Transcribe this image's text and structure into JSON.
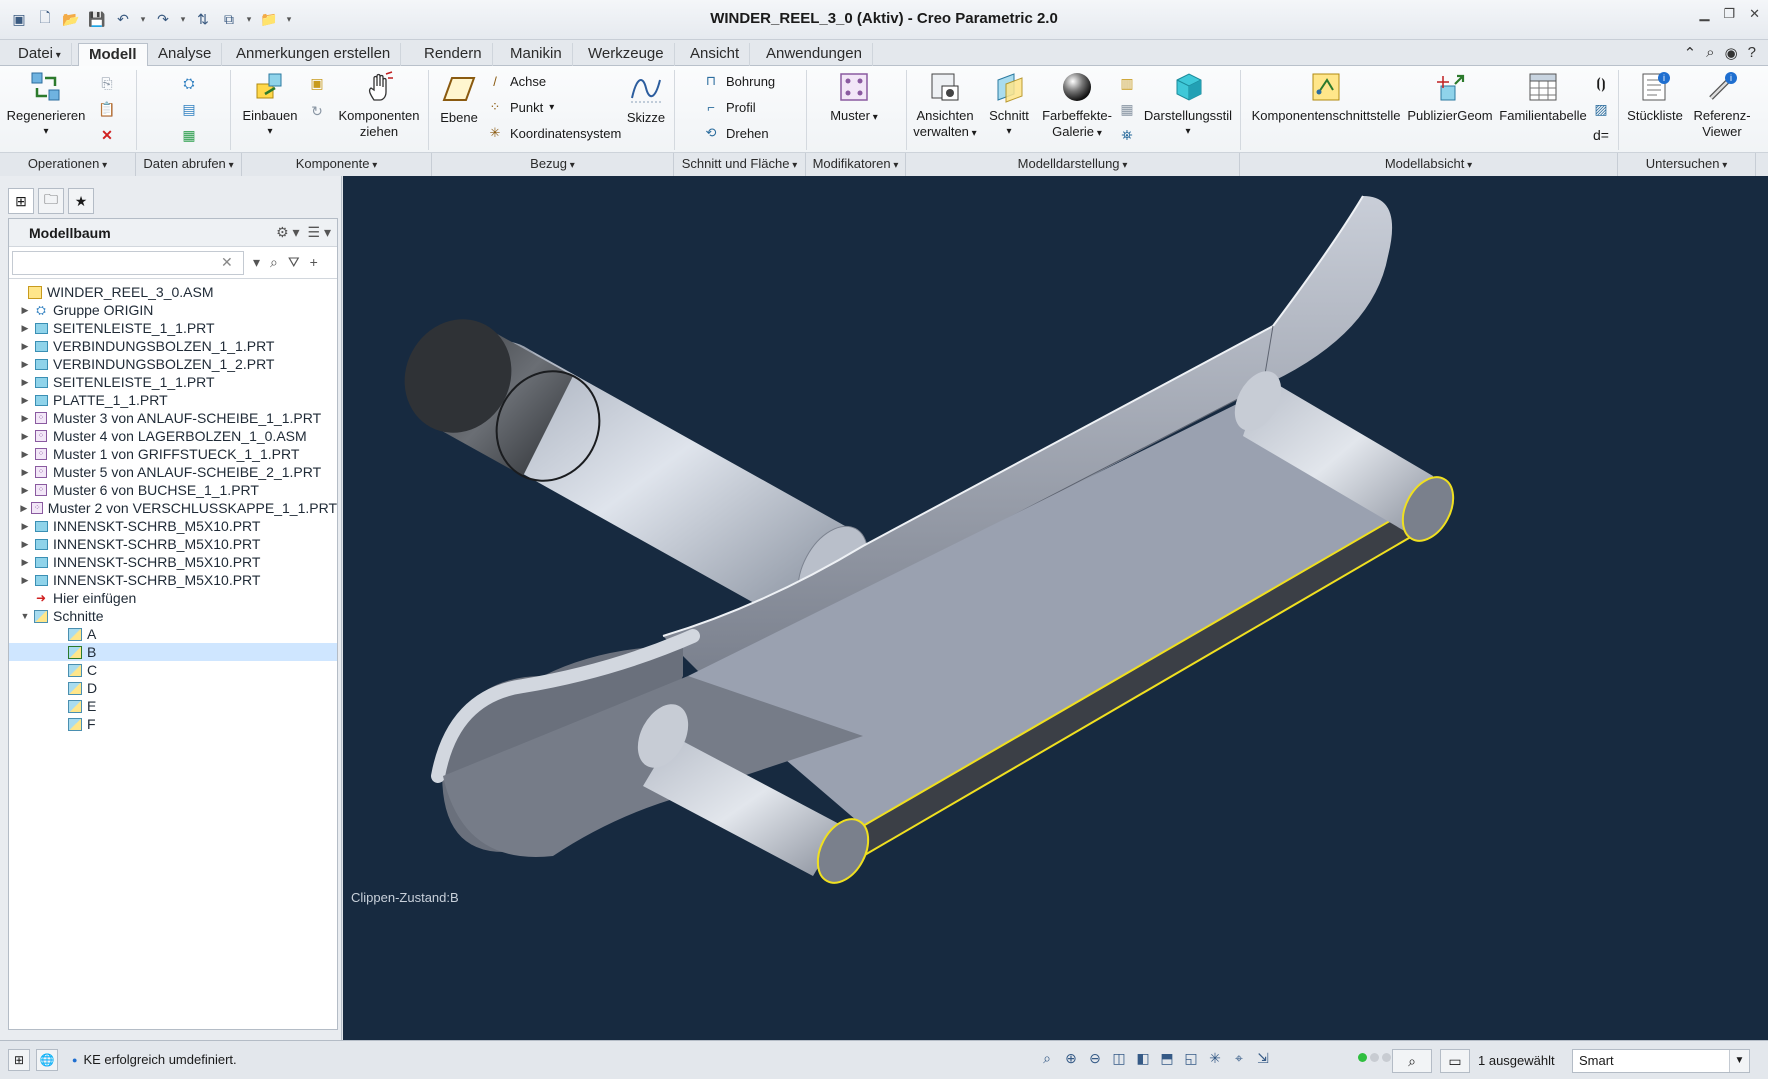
{
  "window": {
    "title": "WINDER_REEL_3_0 (Aktiv) - Creo Parametric 2.0"
  },
  "tabs": [
    {
      "label": "Datei",
      "active": false
    },
    {
      "label": "Modell",
      "active": true
    },
    {
      "label": "Analyse",
      "active": false
    },
    {
      "label": "Anmerkungen erstellen",
      "active": false
    },
    {
      "label": "Rendern",
      "active": false
    },
    {
      "label": "Manikin",
      "active": false
    },
    {
      "label": "Werkzeuge",
      "active": false
    },
    {
      "label": "Ansicht",
      "active": false
    },
    {
      "label": "Anwendungen",
      "active": false
    }
  ],
  "ribbon": {
    "regenerate": "Regenerieren",
    "assemble": "Einbauen",
    "drag_components": [
      "Komponenten",
      "ziehen"
    ],
    "plane": "Ebene",
    "axis": "Achse",
    "point": "Punkt",
    "csys": "Koordinatensystem",
    "sketch": "Skizze",
    "hole": "Bohrung",
    "profile": "Profil",
    "revolve": "Drehen",
    "pattern": "Muster",
    "manage_views": [
      "Ansichten",
      "verwalten"
    ],
    "section": "Schnitt",
    "appearance_gallery": [
      "Farbeffekte-",
      "Galerie"
    ],
    "display_style": "Darstellungsstil",
    "component_interface": "Komponentenschnittstelle",
    "publish_geom": "PublizierGeom",
    "family_table": "Familientabelle",
    "bom": "Stückliste",
    "reference_viewer": [
      "Referenz-",
      "Viewer"
    ]
  },
  "groups": [
    {
      "label": "Operationen"
    },
    {
      "label": "Daten abrufen"
    },
    {
      "label": "Komponente"
    },
    {
      "label": "Bezug"
    },
    {
      "label": "Schnitt und Fläche"
    },
    {
      "label": "Modifikatoren"
    },
    {
      "label": "Modelldarstellung"
    },
    {
      "label": "Modellabsicht"
    },
    {
      "label": "Untersuchen"
    }
  ],
  "model_tree": {
    "title": "Modellbaum",
    "search_value": "",
    "items": [
      {
        "label": "WINDER_REEL_3_0.ASM",
        "type": "asm",
        "level": 0,
        "expander": ""
      },
      {
        "label": "Gruppe ORIGIN",
        "type": "group",
        "level": 1,
        "expander": "▶"
      },
      {
        "label": "SEITENLEISTE_1_1.PRT",
        "type": "prt",
        "level": 1,
        "expander": "▶"
      },
      {
        "label": "VERBINDUNGSBOLZEN_1_1.PRT",
        "type": "prt",
        "level": 1,
        "expander": "▶"
      },
      {
        "label": "VERBINDUNGSBOLZEN_1_2.PRT",
        "type": "prt",
        "level": 1,
        "expander": "▶"
      },
      {
        "label": "SEITENLEISTE_1_1.PRT",
        "type": "prt",
        "level": 1,
        "expander": "▶"
      },
      {
        "label": "PLATTE_1_1.PRT",
        "type": "prt",
        "level": 1,
        "expander": "▶"
      },
      {
        "label": "Muster 3 von ANLAUF-SCHEIBE_1_1.PRT",
        "type": "pat",
        "level": 1,
        "expander": "▶"
      },
      {
        "label": "Muster 4 von LAGERBOLZEN_1_0.ASM",
        "type": "pat",
        "level": 1,
        "expander": "▶"
      },
      {
        "label": "Muster 1 von GRIFFSTUECK_1_1.PRT",
        "type": "pat",
        "level": 1,
        "expander": "▶"
      },
      {
        "label": "Muster 5 von ANLAUF-SCHEIBE_2_1.PRT",
        "type": "pat",
        "level": 1,
        "expander": "▶"
      },
      {
        "label": "Muster 6 von BUCHSE_1_1.PRT",
        "type": "pat",
        "level": 1,
        "expander": "▶"
      },
      {
        "label": "Muster 2 von VERSCHLUSSKAPPE_1_1.PRT",
        "type": "pat",
        "level": 1,
        "expander": "▶"
      },
      {
        "label": "INNENSKT-SCHRB_M5X10.PRT",
        "type": "prt",
        "level": 1,
        "expander": "▶"
      },
      {
        "label": "INNENSKT-SCHRB_M5X10.PRT",
        "type": "prt",
        "level": 1,
        "expander": "▶"
      },
      {
        "label": "INNENSKT-SCHRB_M5X10.PRT",
        "type": "prt",
        "level": 1,
        "expander": "▶"
      },
      {
        "label": "INNENSKT-SCHRB_M5X10.PRT",
        "type": "prt",
        "level": 1,
        "expander": "▶"
      },
      {
        "label": "Hier einfügen",
        "type": "insert",
        "level": 1,
        "expander": ""
      },
      {
        "label": "Schnitte",
        "type": "folder",
        "level": 1,
        "expander": "▼"
      },
      {
        "label": "A",
        "type": "sect",
        "level": 2,
        "expander": ""
      },
      {
        "label": "B",
        "type": "sect-active",
        "level": 2,
        "expander": "",
        "selected": true
      },
      {
        "label": "C",
        "type": "sect",
        "level": 2,
        "expander": ""
      },
      {
        "label": "D",
        "type": "sect",
        "level": 2,
        "expander": ""
      },
      {
        "label": "E",
        "type": "sect",
        "level": 2,
        "expander": ""
      },
      {
        "label": "F",
        "type": "sect",
        "level": 2,
        "expander": ""
      }
    ]
  },
  "viewport": {
    "clip_state": "Clippen-Zustand:B",
    "background": "#172a40",
    "highlight": "#f0e020"
  },
  "status": {
    "message": "KE erfolgreich umdefiniert.",
    "selected_count": "1 ausgewählt",
    "filter": "Smart"
  }
}
